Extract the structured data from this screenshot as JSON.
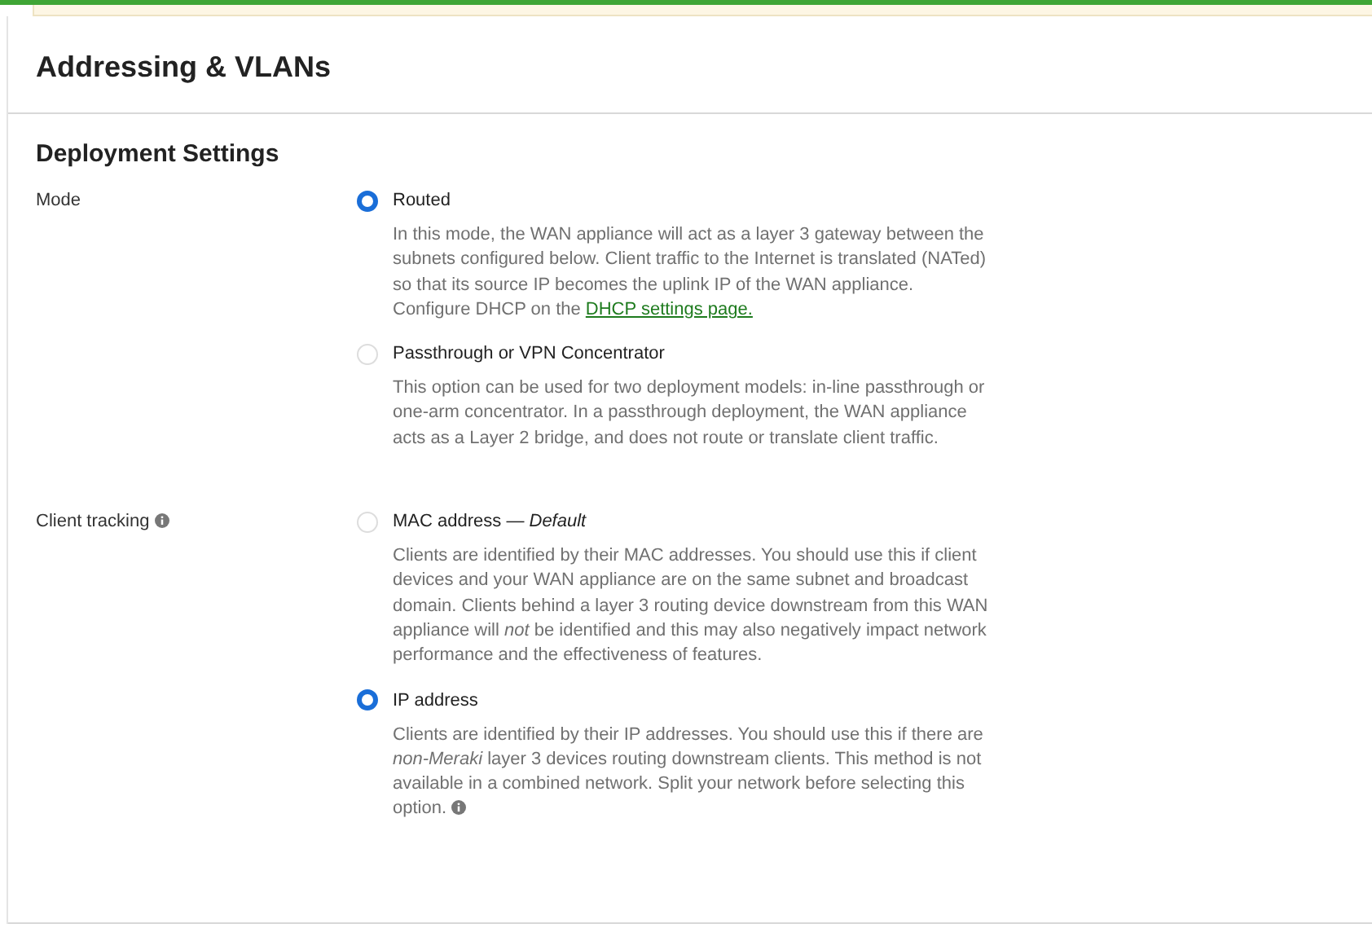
{
  "page": {
    "title": "Addressing & VLANs"
  },
  "section": {
    "title": "Deployment Settings",
    "fields": [
      {
        "label": "Mode",
        "info": false,
        "options": [
          {
            "label": "Routed",
            "selected": true,
            "description": "In this mode, the WAN appliance will act as a layer 3 gateway between the subnets configured below. Client traffic to the Internet is translated (NATed) so that its source IP becomes the uplink IP of the WAN appliance.",
            "link_prefix": "Configure DHCP on the ",
            "link": "DHCP settings page.",
            "info": false
          },
          {
            "label": "Passthrough or VPN Concentrator",
            "selected": false,
            "description": "This option can be used for two deployment models: in-line passthrough or one-arm concentrator. In a passthrough deployment, the WAN appliance acts as a Layer 2 bridge, and does not route or translate client traffic.",
            "info": false
          }
        ]
      },
      {
        "label": "Client tracking",
        "info": true,
        "options": [
          {
            "label": "MAC address — *Default*",
            "selected": false,
            "description": "Clients are identified by their MAC addresses. You should use this if client devices and your WAN appliance are on the same subnet and broadcast domain. Clients behind a layer 3 routing device downstream from this WAN appliance will *not* be identified and this may also negatively impact network performance and the effectiveness of features.",
            "info": false
          },
          {
            "label": "IP address",
            "selected": true,
            "description": "Clients are identified by their IP addresses. You should use this if there are *non-Meraki* layer 3 devices routing downstream clients. This method is not available in a combined network. Split your network before selecting this option.",
            "info": true
          }
        ]
      }
    ]
  }
}
